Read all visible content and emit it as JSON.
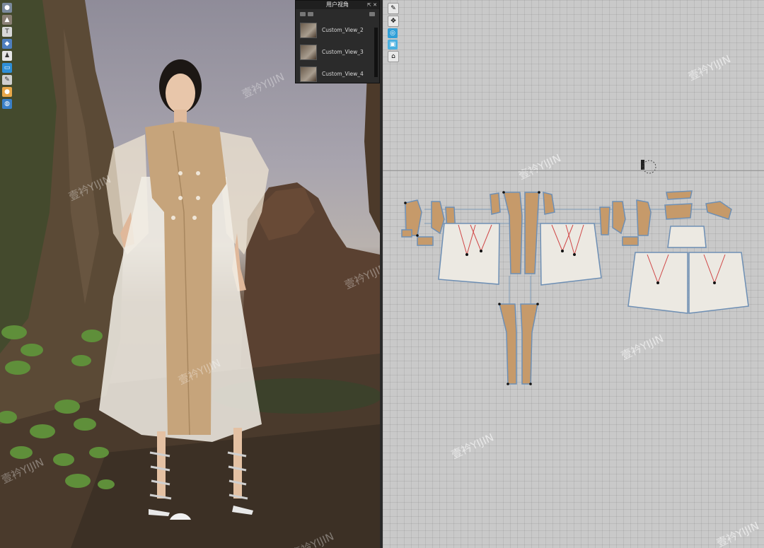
{
  "view_panel": {
    "title": "用户视角",
    "items": [
      {
        "label": "Custom_View_2"
      },
      {
        "label": "Custom_View_3"
      },
      {
        "label": "Custom_View_4"
      }
    ]
  },
  "watermark": "壹衿YIJIN",
  "colors": {
    "pattern_bg": "#c9c9c9",
    "piece_tan": "#c69a6a",
    "piece_white": "#ece9e2",
    "outline_blue": "#6e8fb4",
    "fabric_beige": "#c8a67e",
    "organza_white": "#f3f0e8"
  },
  "toolbar_icons": [
    "avatar-icon",
    "garment-icon",
    "shirt-icon",
    "fabric-icon",
    "person-icon",
    "monitor-icon",
    "pencil-icon",
    "light-icon",
    "globe-icon"
  ],
  "pattern_tool_icons": [
    "brush-icon",
    "transform-icon",
    "zoom-icon",
    "display-icon",
    "sew-icon"
  ]
}
